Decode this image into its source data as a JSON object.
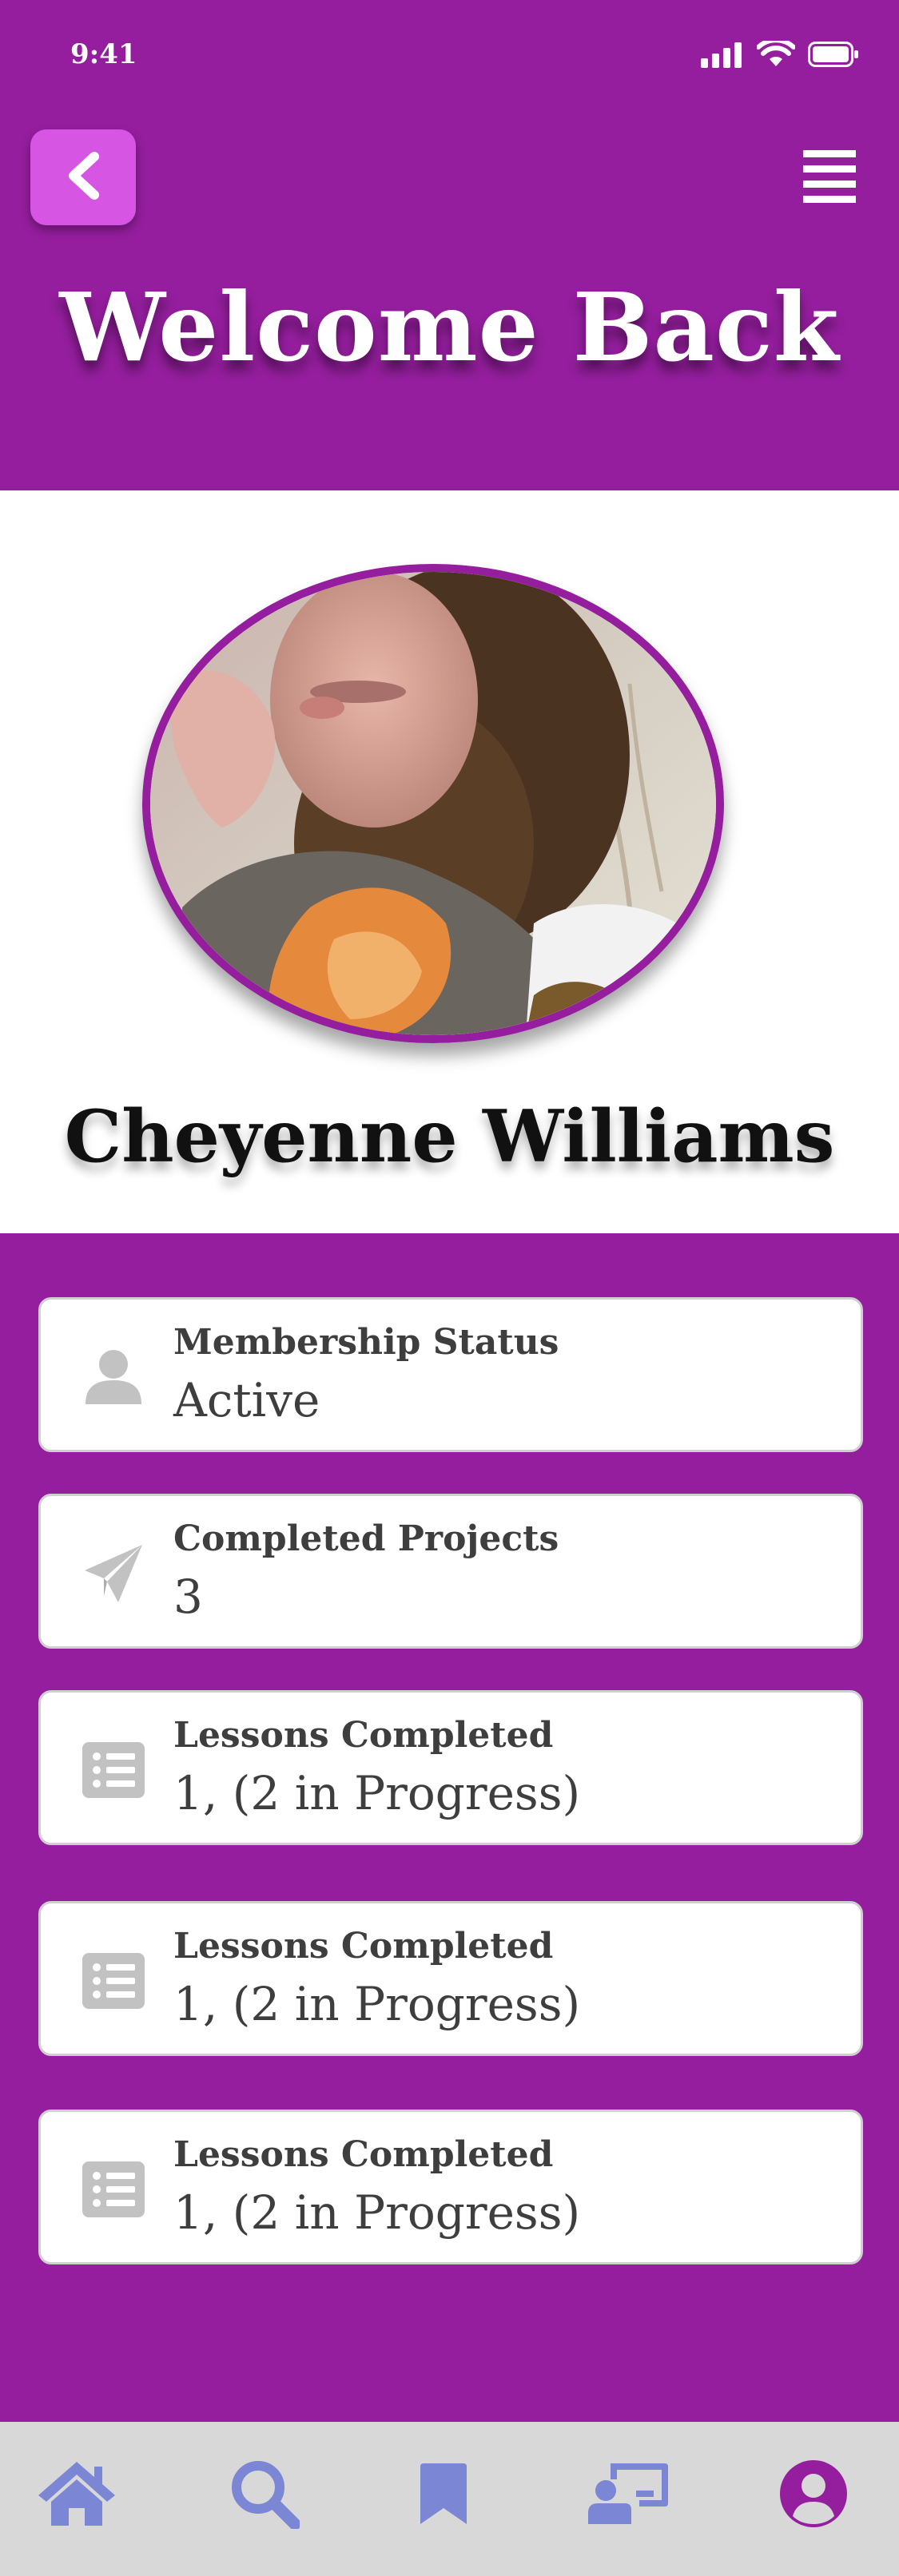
{
  "status_bar": {
    "time": "9:41"
  },
  "header": {
    "title": "Welcome Back"
  },
  "profile": {
    "name": "Cheyenne Williams"
  },
  "cards": [
    {
      "label": "Membership Status",
      "value": "Active",
      "icon": "user-icon"
    },
    {
      "label": "Completed Projects",
      "value": "3",
      "icon": "paper-plane-icon"
    },
    {
      "label": "Lessons Completed",
      "value": "1, (2 in Progress)",
      "icon": "list-icon"
    },
    {
      "label": "Lessons Completed",
      "value": "1, (2 in Progress)",
      "icon": "list-icon"
    },
    {
      "label": "Lessons Completed",
      "value": "1, (2 in Progress)",
      "icon": "list-icon"
    }
  ],
  "nav": {
    "items": [
      "home-icon",
      "search-icon",
      "bookmark-icon",
      "chalkboard-teacher-icon",
      "user-circle-icon"
    ],
    "active": "user-circle-icon"
  },
  "colors": {
    "primary": "#951e9e",
    "accent": "#d655e2",
    "nav_icon": "#7b86d4",
    "card_icon": "#c2c2c2",
    "nav_background": "#d8d8d8"
  }
}
